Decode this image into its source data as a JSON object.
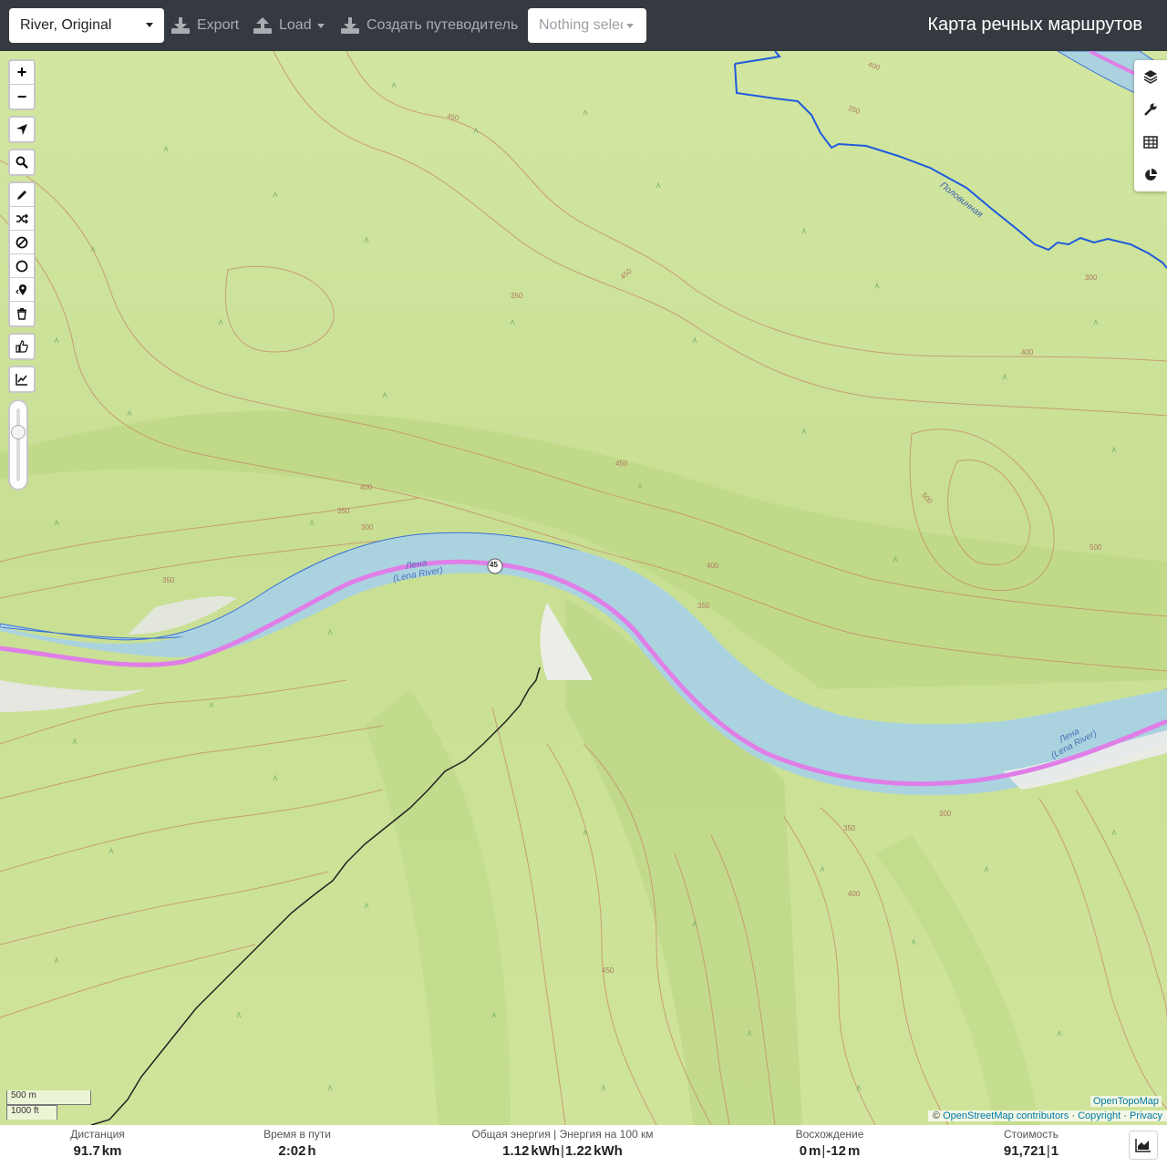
{
  "navbar": {
    "profile": "River, Original",
    "export_label": "Export",
    "load_label": "Load",
    "guide_label": "Создать путеводитель",
    "selection_placeholder": "Nothing selected",
    "brand": "Карта речных маршрутов"
  },
  "map": {
    "river_name_1": "Лена",
    "river_name_1_alt": "(Lena River)",
    "river_name_2": "Лена",
    "river_name_2_alt": "(Lena River)",
    "stream_name": "Половинная",
    "route_marker": "45",
    "contour_labels": [
      "400",
      "350",
      "450",
      "300",
      "500",
      "400",
      "350",
      "450",
      "400",
      "350",
      "300",
      "350",
      "400",
      "450",
      "500",
      "350",
      "300",
      "350",
      "400",
      "450"
    ],
    "colors": {
      "terrain": "#cfe49a",
      "water": "#aad3df",
      "route": "#e07ee8",
      "stream": "#1f5bdc",
      "contour": "#c7866a",
      "track": "#222222"
    }
  },
  "controls": {
    "zoom_in": "+",
    "zoom_out": "−"
  },
  "scale": {
    "metric": "500 m",
    "imperial": "1000 ft"
  },
  "attribution": {
    "otm": "OpenTopoMap",
    "prefix": "©",
    "osm": "OpenStreetMap contributors",
    "sep1": "·",
    "copyright": "Copyright",
    "sep2": "·",
    "privacy": "Privacy"
  },
  "stats": {
    "distance": {
      "label": "Дистанция",
      "value": "91.7",
      "unit": "km"
    },
    "time": {
      "label": "Время в пути",
      "value": "2:02",
      "unit": "h"
    },
    "energy": {
      "label": "Общая энергия | Энергия на 100 км",
      "value1": "1.12",
      "unit1": "kWh",
      "sep": "|",
      "value2": "1.22",
      "unit2": "kWh"
    },
    "ascent": {
      "label": "Восхождение",
      "value1": "0",
      "unit1": "m",
      "sep": "|",
      "value2": "-12",
      "unit2": "m"
    },
    "cost": {
      "label": "Стоимость",
      "value1": "91,721",
      "sep": "|",
      "value2": "1"
    }
  }
}
